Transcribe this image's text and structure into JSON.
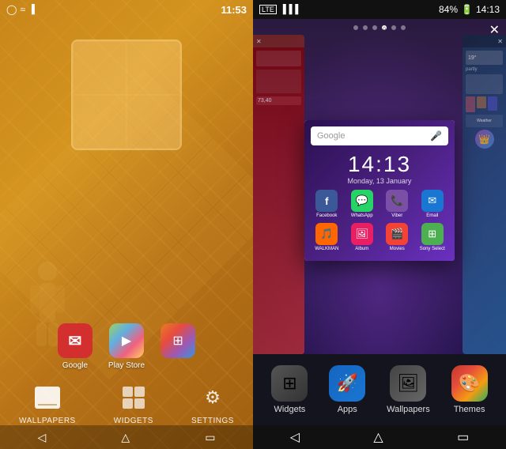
{
  "left": {
    "status": {
      "time": "11:53",
      "icons": [
        "bluetooth",
        "wifi",
        "battery"
      ]
    },
    "bottomMenu": {
      "items": [
        {
          "id": "wallpapers",
          "label": "WALLPAPERS"
        },
        {
          "id": "widgets",
          "label": "WIDGETS"
        },
        {
          "id": "settings",
          "label": "SETTINGS"
        }
      ]
    },
    "apps": [
      {
        "id": "gmail",
        "label": "Google",
        "bg": "#d32f2f",
        "emoji": "✉"
      },
      {
        "id": "playstore",
        "label": "Play Store",
        "bg": "#1976d2",
        "emoji": "▶"
      }
    ],
    "nav": [
      "back",
      "home",
      "recents"
    ]
  },
  "right": {
    "status": {
      "battery": "84%",
      "time": "14:13",
      "signal": "LTE"
    },
    "pageDots": [
      "dot",
      "dot",
      "dot",
      "home",
      "dot",
      "dot"
    ],
    "phoneScreen": {
      "googleBar": "Google",
      "clockTime": "14:13",
      "clockDate": "Monday, 13 January",
      "appsRow1": [
        {
          "label": "Facebook",
          "bg": "#3b5998",
          "emoji": "f"
        },
        {
          "label": "WhatsApp",
          "bg": "#25d366",
          "emoji": "💬"
        },
        {
          "label": "Viber",
          "bg": "#7b4fa6",
          "emoji": "📞"
        },
        {
          "label": "Email",
          "bg": "#1976d2",
          "emoji": "✉"
        }
      ],
      "appsRow2": [
        {
          "label": "WALKMAN",
          "bg": "#ff6600",
          "emoji": "🎵"
        },
        {
          "label": "Album",
          "bg": "#e91e63",
          "emoji": "🖼"
        },
        {
          "label": "Movies",
          "bg": "#f44336",
          "emoji": "🎬"
        },
        {
          "label": "Sony Select",
          "bg": "#4caf50",
          "emoji": "⊞"
        }
      ]
    },
    "dock": [
      {
        "id": "widgets",
        "label": "Widgets",
        "bg": "#333",
        "emoji": "⊞"
      },
      {
        "id": "apps",
        "label": "Apps",
        "bg": "#1976d2",
        "emoji": "🚀"
      },
      {
        "id": "wallpapers",
        "label": "Wallpapers",
        "bg": "#555",
        "emoji": "🖼"
      },
      {
        "id": "themes",
        "label": "Themes",
        "bg": "#444",
        "emoji": "🎨"
      }
    ],
    "nav": [
      "back",
      "home",
      "recents"
    ]
  }
}
